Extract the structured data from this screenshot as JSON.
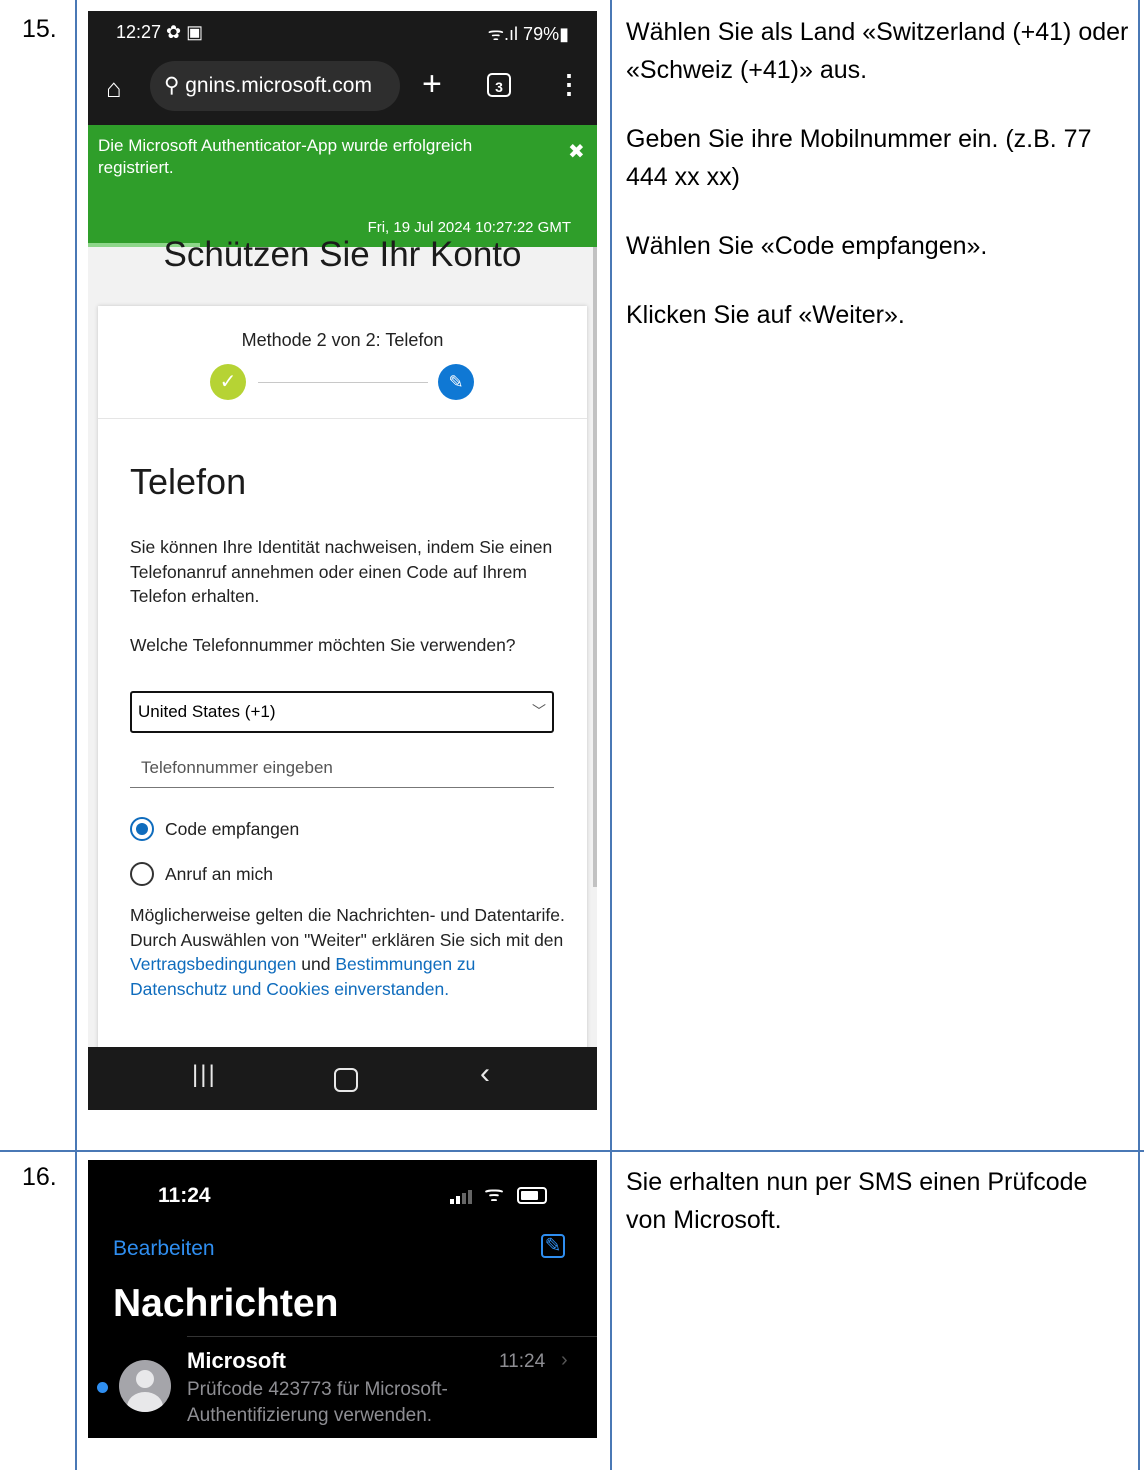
{
  "steps": [
    {
      "number": "15.",
      "instructions": [
        "Wählen Sie als Land «Switzerland (+41) oder «Schweiz (+41)» aus.",
        "Geben Sie ihre Mobilnummer ein. (z.B. 77 444 xx xx)",
        "Wählen Sie «Code empfangen».",
        "Klicken Sie auf «Weiter»."
      ],
      "phone": {
        "status_time": "12:27 ✿ ▣",
        "status_right": "ᯤ.ıl 79%▮",
        "url": "gnins.microsoft.com",
        "tab_count": "3",
        "toast_message": "Die Microsoft Authenticator-App wurde erfolgreich registriert.",
        "toast_close": "✖",
        "toast_date": "Fri, 19 Jul 2024 10:27:22 GMT",
        "page_heading": "Schützen Sie Ihr Konto",
        "method_label": "Methode 2 von 2: Telefon",
        "section_title": "Telefon",
        "description": "Sie können Ihre Identität nachweisen, indem Sie einen Telefonanruf annehmen oder einen Code auf Ihrem Telefon erhalten.",
        "question": "Welche Telefonnummer möchten Sie verwenden?",
        "country_selected": "United States (+1)",
        "phone_placeholder": "Telefonnummer eingeben",
        "radio_sms": "Code empfangen",
        "radio_call": "Anruf an mich",
        "disclaimer_1": "Möglicherweise gelten die Nachrichten- und Datentarife. Durch Auswählen von \"Weiter\" erklären Sie sich mit den ",
        "terms_link": "Vertragsbedingungen",
        "disclaimer_2": " und ",
        "privacy_link": "Bestimmungen zu Datenschutz und Cookies einverstanden."
      }
    },
    {
      "number": "16.",
      "instructions": [
        "Sie erhalten nun per SMS einen Prüfcode von Microsoft."
      ],
      "phone": {
        "time": "11:24",
        "edit_label": "Bearbeiten",
        "title": "Nachrichten",
        "sender": "Microsoft",
        "message_time": "11:24",
        "preview": "Prüfcode 423773 für Microsoft-Authentifizierung verwenden."
      }
    }
  ]
}
